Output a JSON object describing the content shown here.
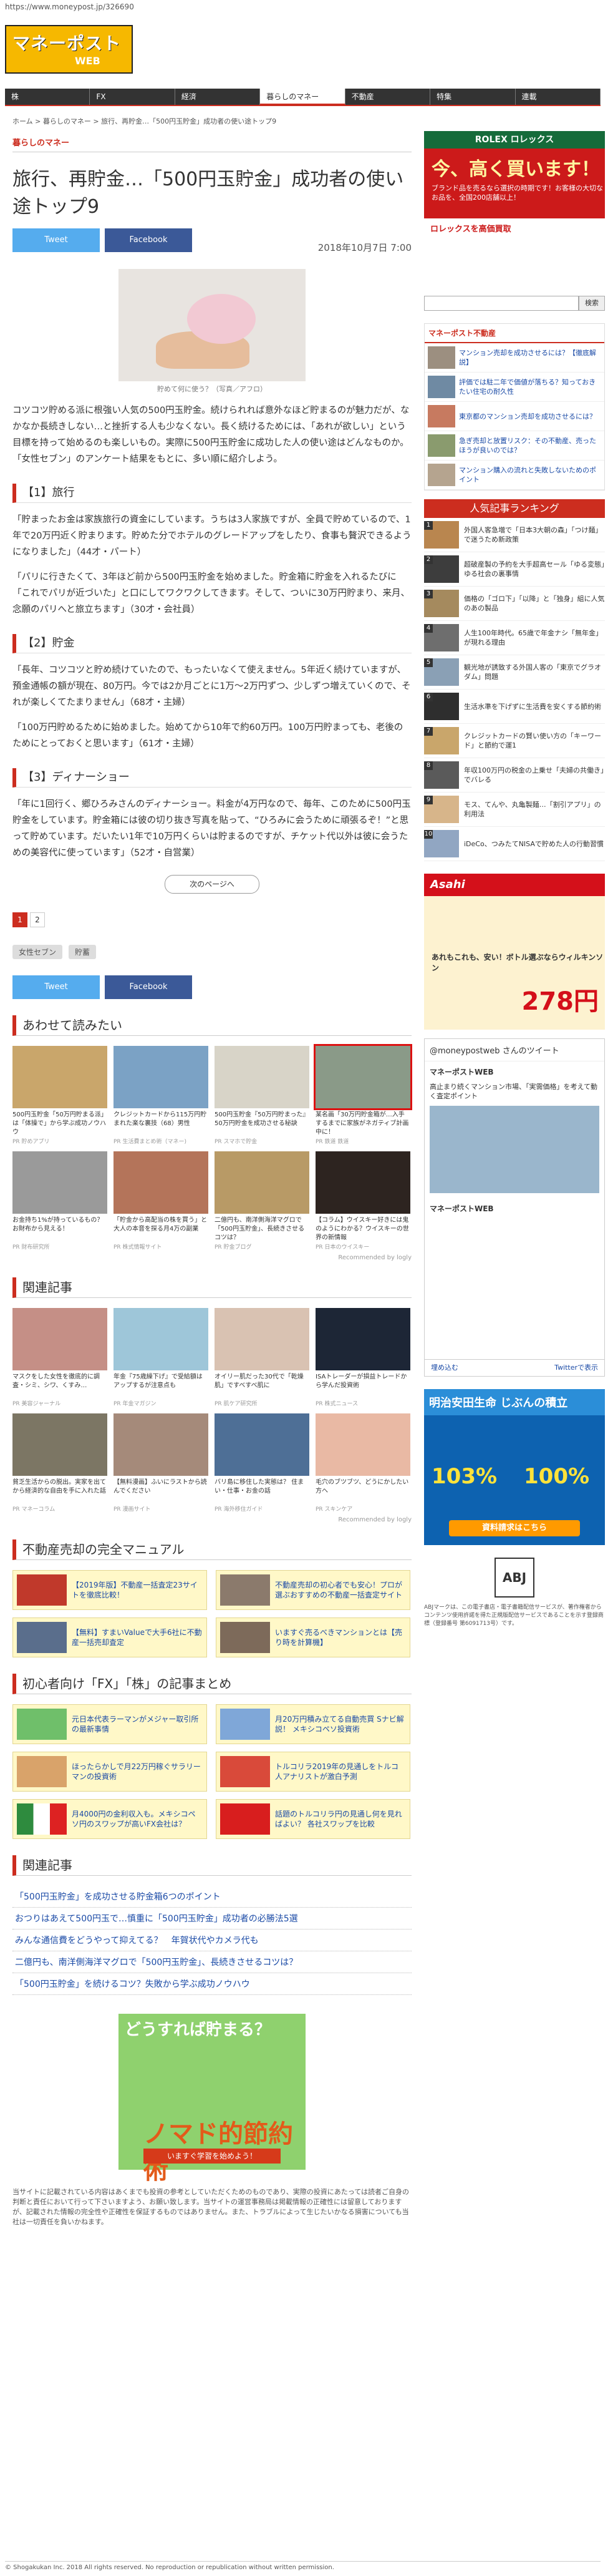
{
  "browser": {
    "url": "https://www.moneypost.jp/326690"
  },
  "logo": {
    "main": "マネーポスト",
    "sub": "WEB"
  },
  "nav": [
    "株",
    "FX",
    "経済",
    "暮らしのマネー",
    "不動産",
    "特集",
    "連載"
  ],
  "nav_active": 3,
  "breadcrumb": "ホーム > 暮らしのマネー > 旅行、再貯金…「500円玉貯金」成功者の使い途トップ9",
  "category": "暮らしのマネー",
  "article": {
    "title": "旅行、再貯金…「500円玉貯金」成功者の使い途トップ9",
    "date": "2018年10月7日 7:00",
    "photo_caption": "貯めて何に使う？（写真／アフロ）",
    "intro": "コツコツ貯める派に根強い人気の500円玉貯金。続けられれば意外なほど貯まるのが魅力だが、なかなか長続きしない…と挫折する人も少なくない。長く続けるためには、「あれが欲しい」という目標を持って始めるのも楽しいもの。実際に500円玉貯金に成功した人の使い途はどんなものか。「女性セブン」のアンケート結果をもとに、多い順に紹介しよう。",
    "h_travel": "【1】旅行",
    "p_travel1": "「貯まったお金は家族旅行の資金にしています。うちは3人家族ですが、全員で貯めているので、1年で20万円近く貯まります。貯めた分でホテルのグレードアップをしたり、食事も贅沢できるようになりました」（44才・パート）",
    "p_travel2": "「パリに行きたくて、3年ほど前から500円玉貯金を始めました。貯金箱に貯金を入れるたびに「これでパリが近づいた」と口にしてワクワクしてきます。そして、ついに30万円貯まり、来月、念願のパリへと旅立ちます」（30才・会社員）",
    "h_save": "【2】貯金",
    "p_save1": "「長年、コツコツと貯め続けていたので、もったいなくて使えません。5年近く続けていますが、預金通帳の額が現在、80万円。今では2か月ごとに1万〜2万円ずつ、少しずつ増えていくので、それが楽しくてたまりません」（68才・主婦）",
    "p_save2": "「100万円貯めるために始めました。始めてから10年で約60万円。100万円貯まっても、老後のためにとっておくと思います」（61才・主婦）",
    "h_dinner": "【3】ディナーショー",
    "p_dinner": "「年に1回行く、郷ひろみさんのディナーショー。料金が4万円なので、毎年、このために500円玉貯金をしています。貯金箱には彼の切り抜き写真を貼って、“ひろみに会うために頑張るぞ！”と思って貯めています。だいたい1年で10万円くらいは貯まるのですが、チケット代以外は彼に会うための美容代に使っています」（52才・自営業）",
    "next": "次のページへ",
    "pages": [
      "1",
      "2"
    ],
    "tags": [
      "女性セブン",
      "貯蓄"
    ]
  },
  "share": {
    "twitter": "Tweet",
    "facebook": "Facebook"
  },
  "related1": {
    "title": "あわせて読みたい",
    "items": [
      {
        "text": "500円玉貯金「50万円貯まる派」は「体操で」から学ぶ成功ノウハウ",
        "src": "PR 貯めアプリ"
      },
      {
        "text": "クレジットカードから115万円貯まれた楽な裏技（68）男性",
        "src": "PR 生活費まとめ術（マネー)"
      },
      {
        "text": "500円玉貯金『50万円貯まった』50万円貯金を成功させる秘訣",
        "src": "PR スマホで貯金"
      },
      {
        "text": "某名画「30万円貯金箱が…入手するまでに家族がネガティブ計画中に！",
        "src": "PR 鉄道 鉄道"
      },
      {
        "text": "お金持ち1%が持っているもの？お財布から見える！",
        "src": "PR 財布研究所"
      },
      {
        "text": "「貯金から高配当の株を買う」と大人の本音を探る月4万の副業",
        "src": "PR 株式情報サイト"
      },
      {
        "text": "二億円も、南洋側海洋マグロで「500円玉貯金」、長続きさせるコツは？",
        "src": "PR 貯金ブログ"
      },
      {
        "text": "【コラム】ウイスキー好きには鬼のようにわかる？ウイスキーの世界の新情報",
        "src": "PR 日本のウイスキー"
      }
    ],
    "recommended": "Recommended by logly"
  },
  "related2": {
    "title": "関連記事",
    "items": [
      {
        "text": "マスクをした女性を徹底的に調査・シミ、シワ、くすみ…",
        "src": "PR 美容ジャーナル"
      },
      {
        "text": "年金『75歳繰下げ』で受給額はアップするが注意点も",
        "src": "PR 年金マガジン"
      },
      {
        "text": "オイリー肌だった30代で「乾燥肌」ですべすべ肌に",
        "src": "PR 肌ケア研究所"
      },
      {
        "text": "ISAトレーダーが損益トレードから学んだ投資術",
        "src": "PR 株式ニュース"
      },
      {
        "text": "貧乏生活からの脱出。実家を出てから経済的な自由を手に入れた話",
        "src": "PR マネーコラム"
      },
      {
        "text": "【無料漫画】ふいにラストから読んでください",
        "src": "PR 漫画サイト"
      },
      {
        "text": "バリ島に移住した実態は？ 住まい・仕事・お金の話",
        "src": "PR 海外移住ガイド"
      },
      {
        "text": "毛穴のブツブツ、どうにかしたい方へ",
        "src": "PR スキンケア"
      }
    ],
    "recommended": "Recommended by logly"
  },
  "realestate": {
    "title": "不動産売却の完全マニュアル",
    "items": [
      "【2019年版】不動産一括査定23サイトを徹底比較！",
      "不動産売却の初心者でも安心！プロが選ぶおすすめの不動産一括査定サイト",
      "【無料】すまいValueで大手6社に不動産一括売却査定",
      "いますぐ売るべきマンションとは【売り時を計算機】"
    ]
  },
  "fxstock": {
    "title": "初心者向け「FX」「株」の記事まとめ",
    "items": [
      "元日本代表ラーマンがメジャー取引所の最新事情",
      "月20万円積み立てる自動売買 Sナビ解説！ メキシコペソ投資術",
      "ほったらかしで月22万円稼ぐサラリーマンの投資術",
      "トルコリラ2019年の見通しをトルコ人アナリストが激白予測",
      "月4000円の金利収入も。メキシコペソ円のスワップが高いFX会社は？",
      "話題のトルコリラ円の見通し何を見ればよい？ 各社スワップを比較"
    ]
  },
  "related3": {
    "title": "関連記事",
    "items": [
      "「500円玉貯金」を成功させる貯金箱6つのポイント",
      "おつりはあえて500円玉で…慎重に「500円玉貯金」成功者の必勝法5選",
      "みんな通信費をどうやって抑えてる？　年賀状代やカメラ代も",
      "二億円も、南洋側海洋マグロで「500円玉貯金」、長続きさせるコツは？",
      "「500円玉貯金」を続けるコツ？失敗から学ぶ成功ノウハウ"
    ]
  },
  "mid_ad": {
    "head": "どうすれば貯まる？",
    "face": "ノマド的節約術",
    "button": "いますぐ学習を始めよう！"
  },
  "disclaimer": "当サイトに記載されている内容はあくまでも投資の参考としていただくためのものであり、実際の投資にあたっては読者ご自身の判断と責任において行って下さいますよう、お願い致します。当サイトの運営事務局は掲載情報の正確性には留意しておりますが、記載された情報の完全性や正確性を保証するものではありません。また、トラブルによって生じたいかなる損害についても当社は一切責任を負いかねます。",
  "footer": "© Shogakukan Inc. 2018 All rights reserved. No reproduction or republication without written permission.",
  "side": {
    "ad1": {
      "brand": "ROLEX ロレックス",
      "head": "今、高く買います！",
      "sub": "ブランド品を売るなら選択の時期です！お客様の大切なお品を、全国200店舗以上！",
      "low": "ロレックスを高価買取"
    },
    "search_button": "検索",
    "realestate_head": "マネーポスト不動産",
    "realestate_items": [
      "マンション売却を成功させるには？【徹底解説】",
      "評価では駐二年で価値が落ちる？知っておきたい住宅の耐久性",
      "東京都のマンション売却を成功させるには？",
      "急ぎ売却と放置リスク：その不動産、売ったほうが良いのでは？",
      "マンション購入の流れと失敗しないためのポイント"
    ],
    "ranking_head": "人気記事ランキング",
    "ranking": [
      "外国人客急増で「日本3大朝の森」「つけ麺」で迷うため新政策",
      "超破産製の予約を大手超高セール「ゆる変態」ゆる社会の裏事情",
      "価格の「ゴロ下」「以降」と「独身」組に人気のあの製品",
      "人生100年時代。65歳で年金ナシ「無年金」が現れる理由",
      "観光地が誘致する外国人客の「東京でグラオダム」問題",
      "生活水準を下げずに生活費を安くする節約術",
      "クレジットカードの賢い使い方の「キーワード」と節約で運1",
      "年収100万円の税金の上乗せ「夫婦の共働き」でバレる",
      "モス、てんや、丸亀製麺…「割引アプリ」の利用法",
      "iDeCo、つみたてNISAで貯めた人の行動習慣"
    ],
    "ad2": {
      "brand": "Asahi",
      "copy": "あれもこれも、安い！ボトル選ぶならウィルキンソン",
      "price": "278円"
    },
    "twitter_head": "@moneypostweb さんのツイート",
    "twitter_account": "マネーポストWEB",
    "twitter_text": "高止まり続くマンション市場、「実需価格」を考えて動く査定ポイント",
    "twitter_embed": "埋め込む",
    "twitter_view": "Twitterで表示",
    "ad3": {
      "head": "明治安田生命 じぶんの積立",
      "rate1": "103%",
      "rate2": "100%",
      "button": "資料請求はこちら"
    },
    "abj_mark": "ABJ",
    "abj_text": "ABJマークは、この電子書店・電子書籍配信サービスが、著作権者からコンテンツ使用許諾を得た正規版配信サービスであることを示す登録商標（登録番号 第6091713号）です。"
  }
}
